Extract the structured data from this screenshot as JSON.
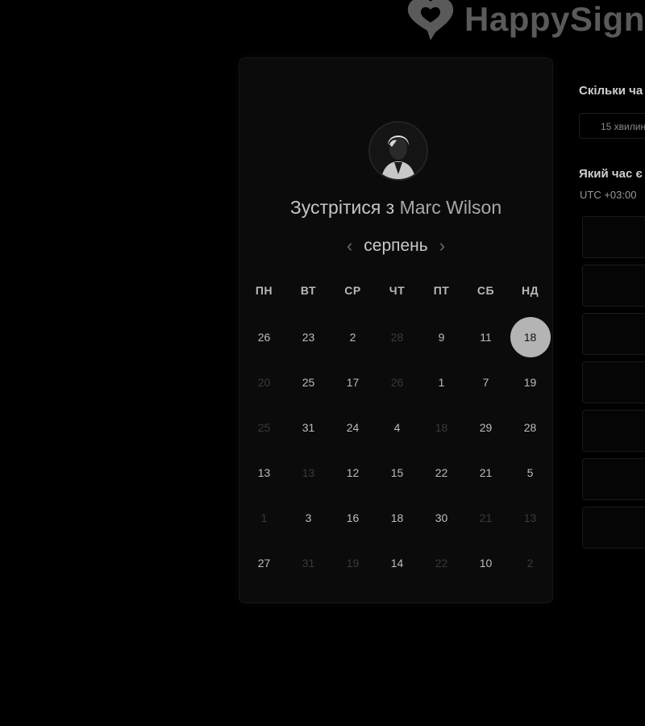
{
  "logo": {
    "text": "HappySign"
  },
  "calendar": {
    "title_prefix": "Зустрітися з",
    "host_name": "Marc Wilson",
    "month": "серпень",
    "prev_icon": "chevron-left-icon",
    "next_icon": "chevron-right-icon",
    "weekdays": [
      "ПН",
      "ВТ",
      "СР",
      "ЧТ",
      "ПТ",
      "СБ",
      "НД"
    ],
    "days": [
      {
        "label": "26",
        "dim": false
      },
      {
        "label": "23",
        "dim": false
      },
      {
        "label": "2",
        "dim": false
      },
      {
        "label": "28",
        "dim": true
      },
      {
        "label": "9",
        "dim": false
      },
      {
        "label": "11",
        "dim": false
      },
      {
        "label": "18",
        "dim": false,
        "selected": true
      },
      {
        "label": "20",
        "dim": true
      },
      {
        "label": "25",
        "dim": false
      },
      {
        "label": "17",
        "dim": false
      },
      {
        "label": "26",
        "dim": true
      },
      {
        "label": "1",
        "dim": false
      },
      {
        "label": "7",
        "dim": false
      },
      {
        "label": "19",
        "dim": false
      },
      {
        "label": "25",
        "dim": true
      },
      {
        "label": "31",
        "dim": false
      },
      {
        "label": "24",
        "dim": false
      },
      {
        "label": "4",
        "dim": false
      },
      {
        "label": "18",
        "dim": true
      },
      {
        "label": "29",
        "dim": false
      },
      {
        "label": "28",
        "dim": false
      },
      {
        "label": "13",
        "dim": false
      },
      {
        "label": "13",
        "dim": true
      },
      {
        "label": "12",
        "dim": false
      },
      {
        "label": "15",
        "dim": false
      },
      {
        "label": "22",
        "dim": false
      },
      {
        "label": "21",
        "dim": false
      },
      {
        "label": "5",
        "dim": false
      },
      {
        "label": "1",
        "dim": true
      },
      {
        "label": "3",
        "dim": false
      },
      {
        "label": "16",
        "dim": false
      },
      {
        "label": "18",
        "dim": false
      },
      {
        "label": "30",
        "dim": false
      },
      {
        "label": "21",
        "dim": true
      },
      {
        "label": "13",
        "dim": true
      },
      {
        "label": "27",
        "dim": false
      },
      {
        "label": "31",
        "dim": true
      },
      {
        "label": "19",
        "dim": true
      },
      {
        "label": "14",
        "dim": false
      },
      {
        "label": "22",
        "dim": true
      },
      {
        "label": "10",
        "dim": false
      },
      {
        "label": "2",
        "dim": true
      }
    ]
  },
  "right_panel": {
    "duration_question": "Скільки ча",
    "duration_value": "15 хвилин",
    "time_question": "Який час є",
    "timezone": "UTC +03:00",
    "slot_count": 7
  },
  "colors": {
    "background": "#000000",
    "card": "#0b0b0b",
    "selected_day": "#b4b4b4"
  }
}
